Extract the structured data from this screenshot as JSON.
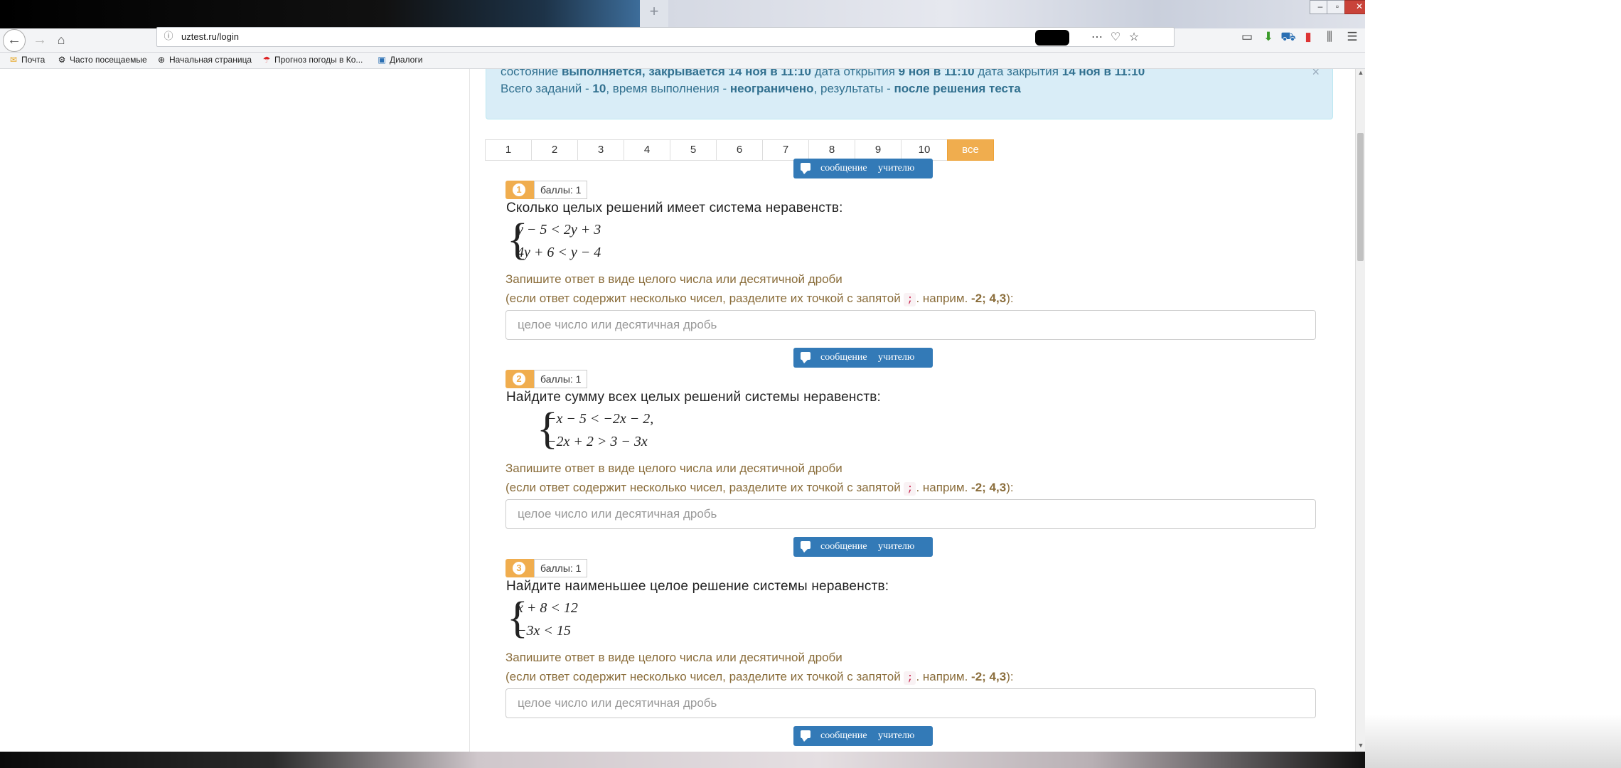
{
  "browser": {
    "new_tab_icon": "+",
    "url": "uztest.ru/login",
    "window_controls": [
      "–",
      "▫",
      "✕"
    ]
  },
  "bookmarks": [
    {
      "label": "Почта",
      "icon": "mail-icon"
    },
    {
      "label": "Часто посещаемые",
      "icon": "gear-icon"
    },
    {
      "label": "Начальная страница",
      "icon": "globe-icon"
    },
    {
      "label": "Прогноз погоды в Ко...",
      "icon": "umbrella-icon"
    },
    {
      "label": "Диалоги",
      "icon": "chat-icon"
    }
  ],
  "alert": {
    "line1_prefix": "состояние",
    "line1_state": "выполняется, закрывается 14 ноя в 11:10",
    "line1_open_label": "дата открытия",
    "line1_open": "9 ноя в 11:10",
    "line1_close_label": "дата закрытия",
    "line1_close": "14 ноя в 11:10",
    "total_label": "Всего заданий - ",
    "total": "10",
    "time_label": ", время выполнения - ",
    "time": "неограничено",
    "results_label": ", результаты - ",
    "results": "после решения теста",
    "close_icon": "×"
  },
  "pager": [
    "1",
    "2",
    "3",
    "4",
    "5",
    "6",
    "7",
    "8",
    "9",
    "10",
    "все"
  ],
  "message_button": "сообщение учителю",
  "questions": [
    {
      "num": "1",
      "score": "баллы: 1",
      "text": "Сколько целых решений имеет система неравенств:",
      "lines": [
        "y − 5 < 2y + 3",
        "4y + 6 < y − 4"
      ]
    },
    {
      "num": "2",
      "score": "баллы: 1",
      "text": "Найдите сумму всех целых решений системы неравенств:",
      "lines": [
        "−x − 5 < −2x − 2,",
        "−2x + 2 > 3 − 3x"
      ]
    },
    {
      "num": "3",
      "score": "баллы: 1",
      "text": "Найдите наименьшее целое решение системы неравенств:",
      "lines": [
        "x + 8 < 12",
        "−3x < 15"
      ]
    }
  ],
  "hint": {
    "line1": "Запишите ответ в виде целого числа или десятичной дроби",
    "line2_prefix": "(если ответ содержит несколько чисел, разделите их точкой с запятой ",
    "separator": ";",
    "line2_mid": ". наприм. ",
    "example": "-2; 4,3",
    "line2_suffix": "):"
  },
  "answer_placeholder": "целое число или десятичная дробь"
}
